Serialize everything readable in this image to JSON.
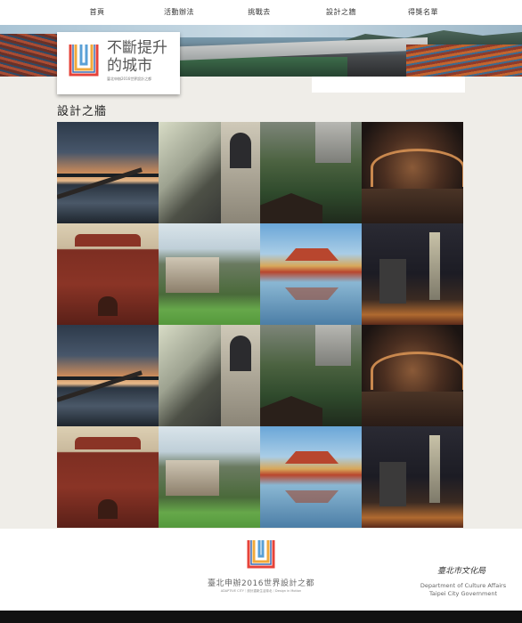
{
  "nav": {
    "items": [
      "首頁",
      "活動辦法",
      "挑戰去",
      "設計之牆",
      "得獎名單"
    ]
  },
  "logo": {
    "title_line1": "不斷提升",
    "title_line2": "的城市",
    "subtitle": "臺北申辦2016世界設計之都",
    "icon": "rainbow-stripes-logo-icon",
    "stripe_colors": [
      "#e6433a",
      "#f2a93b",
      "#5aa0d6",
      "#3b6fb6"
    ]
  },
  "page": {
    "section_title": "設計之牆"
  },
  "gallery": {
    "photos": [
      {
        "subject": "riverside-dusk"
      },
      {
        "subject": "window-building"
      },
      {
        "subject": "hillside-architecture"
      },
      {
        "subject": "station-canopy"
      },
      {
        "subject": "red-house"
      },
      {
        "subject": "hillside-village"
      },
      {
        "subject": "pavilion-reflection"
      },
      {
        "subject": "taipei-101-night"
      },
      {
        "subject": "riverside-dusk"
      },
      {
        "subject": "window-building"
      },
      {
        "subject": "hillside-architecture"
      },
      {
        "subject": "station-canopy"
      },
      {
        "subject": "red-house"
      },
      {
        "subject": "hillside-village"
      },
      {
        "subject": "pavilion-reflection"
      },
      {
        "subject": "taipei-101-night"
      }
    ]
  },
  "footer": {
    "title": "臺北申辦2016世界設計之都",
    "caption": "ADAPTIVE CITY｜設計重新生活臺北｜Design in Motion",
    "dept_signature": "臺北市文化局",
    "dept_en_line1": "Department of Culture Affairs",
    "dept_en_line2": "Taipei City Government"
  }
}
